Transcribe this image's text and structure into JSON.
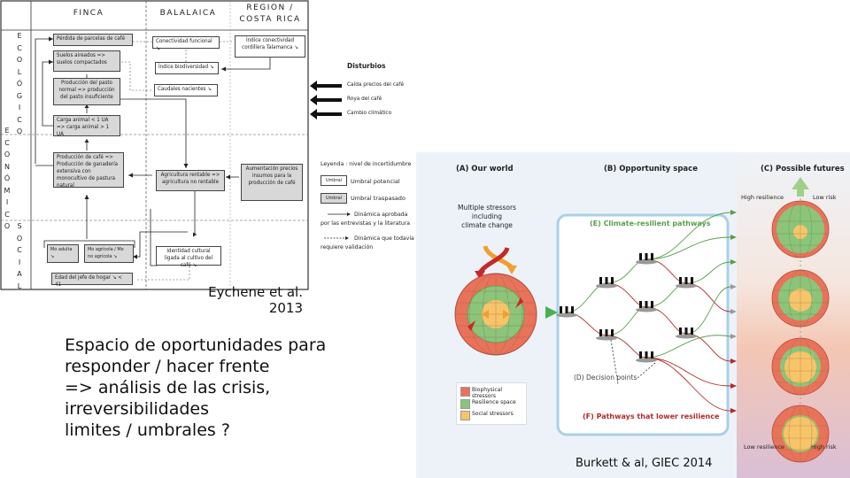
{
  "flowchart": {
    "columns": [
      "FINCA",
      "BALALAICA",
      "REGION / COSTA RICA"
    ],
    "row_labels": {
      "ecologico": [
        "E",
        "C",
        "O",
        "L",
        "Ó",
        "G",
        "I",
        "C",
        "O"
      ],
      "economico": [
        "E",
        "C",
        "O",
        "N",
        "Ó",
        "M",
        "I",
        "C",
        "O"
      ],
      "social": [
        "S",
        "O",
        "C",
        "I",
        "A",
        "L"
      ]
    },
    "boxes": {
      "perdida": "Pérdida de parcelas de café",
      "suelos": "Suelos aireados => suelos compactados",
      "pasto": "Producción del pasto normal => producción del pasto insuficiente",
      "carga": "Carga animal < 1 UA => carga animal > 1 UA",
      "produccion_cafe": "Producción de café => Producción de ganadería extensiva con monocultivo de pastura natural",
      "conectividad": "Conectividad funcional ↘",
      "biodiversidad": "Índice biodiversidad ↘",
      "caudales": "Caudales nacientes ↘",
      "agricultura": "Agricultura rentable => agricultura no rentable",
      "indice_conectividad": "Índice conectividad cordillera Talamanca ↘",
      "aumentacion": "Aumentación precios insumos para la producción de café",
      "mo_adulta": "Mo adulta ↘",
      "mo_agricola": "Mo agrícola / Mo no agrícola ↘",
      "identidad": "Identidad cultural ligada al cultivo del café ↘",
      "edad": "Edad del jefe de hogar ↘ < 41"
    },
    "disturbios": {
      "title": "Disturbios",
      "items": [
        "Caída precios del café",
        "Roya del café",
        "Cambio climático"
      ]
    },
    "legend": {
      "title": "Leyenda : nivel de incertidumbre",
      "umbral_box": "Umbral",
      "umbral_potencial": "Umbral potencial",
      "umbral_traspasado": "Umbral traspasado",
      "solid_line": "Dinámica aprobada por las entrevistas y la literatura",
      "dashed_line": "Dinámica que todavía requiere validación"
    }
  },
  "citations": {
    "eychene_line1": "Eychene et al.",
    "eychene_line2": "2013",
    "burkett": "Burkett & al, GIEC 2014"
  },
  "main_text": {
    "lines": [
      "Espacio de oportunidades para",
      "responder / hacer frente",
      "=> análisis de las crisis,",
      "irreversibilidades",
      "limites / umbrales ?"
    ]
  },
  "ipcc_figure": {
    "panel_a": "(A) Our world",
    "panel_b": "(B) Opportunity space",
    "panel_c": "(C) Possible futures",
    "stressors_text": [
      "Multiple stressors",
      "including",
      "climate change"
    ],
    "climate_resilient": "(E) Climate-resilient pathways",
    "decision_points": "(D) Decision points",
    "lower_resilience": "(F) Pathways that lower resilience",
    "high_resilience": "High resilience",
    "low_risk": "Low risk",
    "low_resilience": "Low resilience",
    "high_risk": "High risk",
    "legend": [
      {
        "label": "Biophysical stressors",
        "color": "#e8735a"
      },
      {
        "label": "Resilience space",
        "color": "#8cc47a"
      },
      {
        "label": "Social stressors",
        "color": "#f7c46a"
      }
    ],
    "colors": {
      "green_path": "#5a9e4a",
      "red_path": "#b22a2a",
      "gray_arrow": "#999999",
      "frame": "#a9d0e6"
    }
  }
}
